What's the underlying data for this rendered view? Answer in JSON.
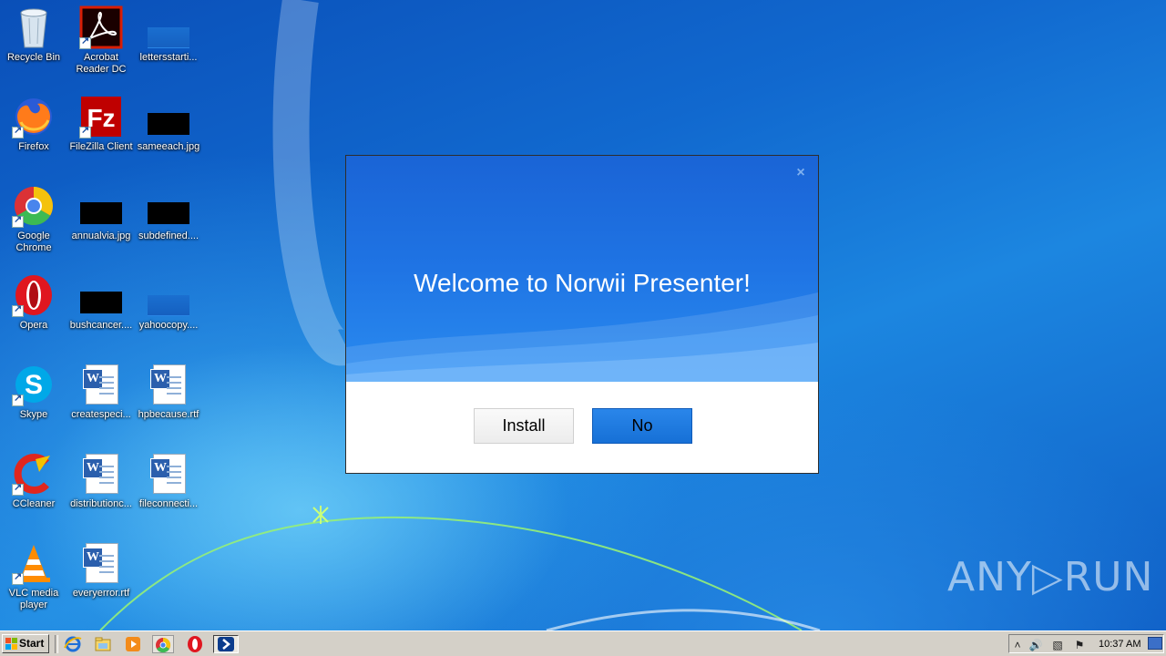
{
  "desktop": {
    "icons": [
      {
        "label": "Recycle Bin"
      },
      {
        "label": "Acrobat Reader DC"
      },
      {
        "label": "lettersstarti..."
      },
      {
        "label": "Firefox"
      },
      {
        "label": "FileZilla Client"
      },
      {
        "label": "sameeach.jpg"
      },
      {
        "label": "Google Chrome"
      },
      {
        "label": "annualvia.jpg"
      },
      {
        "label": "subdefined...."
      },
      {
        "label": "Opera"
      },
      {
        "label": "bushcancer...."
      },
      {
        "label": "yahoocopy...."
      },
      {
        "label": "Skype"
      },
      {
        "label": "createspeci..."
      },
      {
        "label": "hpbecause.rtf"
      },
      {
        "label": "CCleaner"
      },
      {
        "label": "distributionc..."
      },
      {
        "label": "fileconnecti..."
      },
      {
        "label": "VLC media player"
      },
      {
        "label": "everyerror.rtf"
      }
    ]
  },
  "dialog": {
    "title": "Welcome to Norwii Presenter!",
    "install_label": "Install",
    "no_label": "No",
    "close_glyph": "×"
  },
  "watermark": {
    "text": "ANY▷RUN"
  },
  "taskbar": {
    "start_label": "Start",
    "clock": "10:37 AM",
    "pinned": [
      "ie-icon",
      "explorer-icon",
      "media-player-icon",
      "chrome-icon",
      "opera-icon",
      "norwii-icon"
    ]
  },
  "colors": {
    "accent": "#1f74e4",
    "no_button": "#1670d6",
    "taskbar": "#d4d0c8"
  }
}
